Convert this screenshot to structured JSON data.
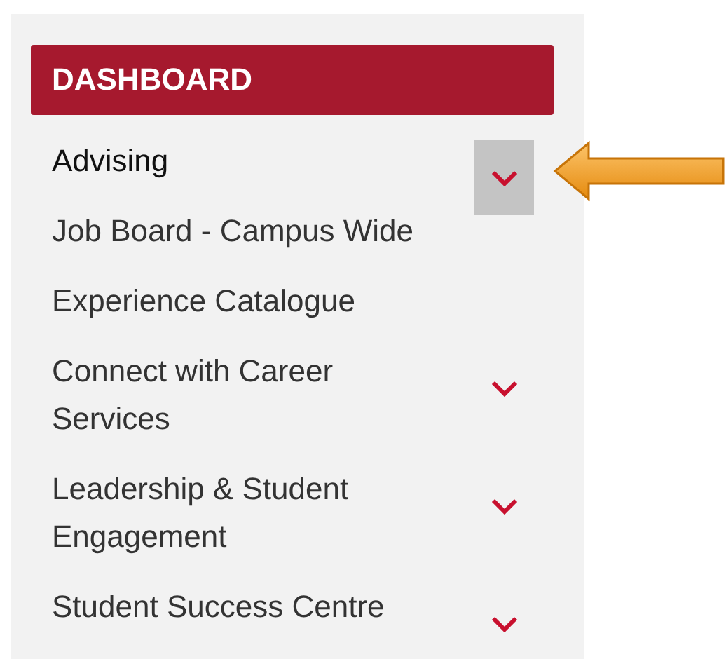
{
  "menu": {
    "title": "DASHBOARD",
    "items": [
      {
        "label": "Advising",
        "expandable": true,
        "focused": true
      },
      {
        "label": "Job Board - Campus Wide",
        "expandable": false,
        "focused": false
      },
      {
        "label": "Experience Catalogue",
        "expandable": false,
        "focused": false
      },
      {
        "label": "Connect with Career Services",
        "expandable": true,
        "focused": false
      },
      {
        "label": "Leadership & Student Engagement",
        "expandable": true,
        "focused": false
      },
      {
        "label": "Student Success Centre",
        "expandable": true,
        "focused": false
      }
    ]
  }
}
